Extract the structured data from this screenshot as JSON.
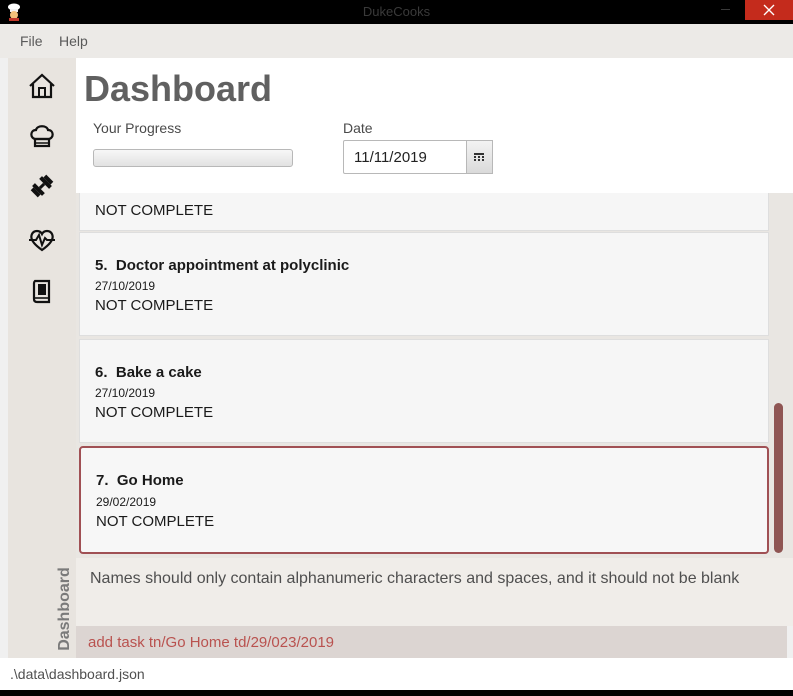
{
  "window": {
    "title": "DukeCooks"
  },
  "menu": {
    "file": "File",
    "help": "Help"
  },
  "sidebar": {
    "items": [
      {
        "icon": "home-icon"
      },
      {
        "icon": "chef-hat-icon"
      },
      {
        "icon": "dumbbell-icon"
      },
      {
        "icon": "heartbeat-icon"
      },
      {
        "icon": "book-icon"
      }
    ],
    "current_section": "Dashboard"
  },
  "dashboard": {
    "title": "Dashboard",
    "progress_label": "Your Progress",
    "progress_value": 0,
    "date_label": "Date",
    "date_value": "11/11/2019"
  },
  "tasks": [
    {
      "status": "NOT COMPLETE"
    },
    {
      "index": "5.",
      "name": "Doctor appointment at polyclinic",
      "date": "27/10/2019",
      "status": "NOT COMPLETE"
    },
    {
      "index": "6.",
      "name": "Bake a cake",
      "date": "27/10/2019",
      "status": "NOT COMPLETE"
    },
    {
      "index": "7.",
      "name": "Go Home",
      "date": "29/02/2019",
      "status": "NOT COMPLETE"
    }
  ],
  "result": {
    "message": "Names should only contain alphanumeric characters and spaces, and it should not be blank"
  },
  "command": {
    "text": "add task tn/Go Home td/29/023/2019"
  },
  "status_bar": {
    "path": ".\\data\\dashboard.json"
  },
  "colors": {
    "accent": "#a05054",
    "scroll_thumb": "#8f5553",
    "command_text": "#b9524f"
  }
}
